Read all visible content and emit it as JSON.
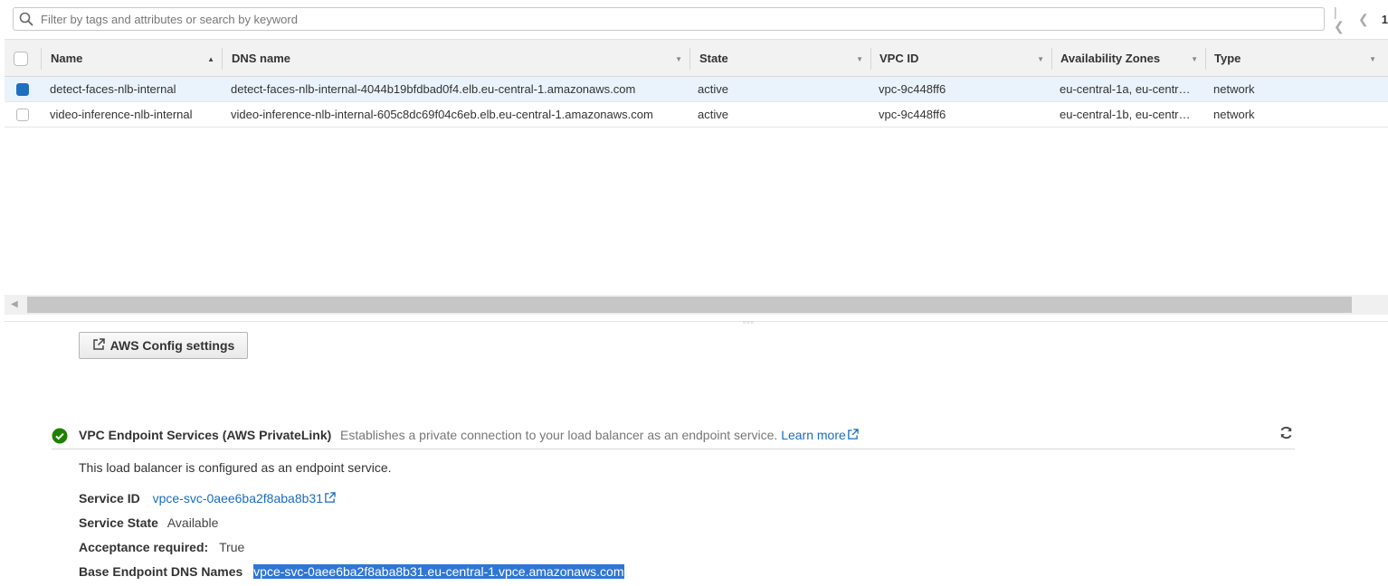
{
  "filter": {
    "placeholder": "Filter by tags and attributes or search by keyword"
  },
  "pager": {
    "page": "1"
  },
  "table": {
    "columns": [
      "Name",
      "DNS name",
      "State",
      "VPC ID",
      "Availability Zones",
      "Type"
    ],
    "rows": [
      {
        "selected": true,
        "name": "detect-faces-nlb-internal",
        "dns": "detect-faces-nlb-internal-4044b19bfdbad0f4.elb.eu-central-1.amazonaws.com",
        "state": "active",
        "vpc": "vpc-9c448ff6",
        "az": "eu-central-1a, eu-centr…",
        "type": "network"
      },
      {
        "selected": false,
        "name": "video-inference-nlb-internal",
        "dns": "video-inference-nlb-internal-605c8dc69f04c6eb.elb.eu-central-1.amazonaws.com",
        "state": "active",
        "vpc": "vpc-9c448ff6",
        "az": "eu-central-1b, eu-centr…",
        "type": "network"
      }
    ]
  },
  "config_button": {
    "label": "AWS Config settings"
  },
  "endpoint": {
    "title": "VPC Endpoint Services (AWS PrivateLink)",
    "description": "Establishes a private connection to your load balancer as an endpoint service.",
    "learn_more": "Learn more",
    "status_text": "This load balancer is configured as an endpoint service.",
    "service_id_label": "Service ID",
    "service_id": "vpce-svc-0aee6ba2f8aba8b31",
    "service_state_label": "Service State",
    "service_state": "Available",
    "acceptance_label": "Acceptance required:",
    "acceptance": "True",
    "dns_names_label": "Base Endpoint DNS Names",
    "dns_names": "vpce-svc-0aee6ba2f8aba8b31.eu-central-1.vpce.amazonaws.com"
  },
  "colors": {
    "link": "#1a6cbd",
    "checked": "#1f6fbf",
    "success": "#1d8102",
    "highlight": "#2f76d6"
  }
}
